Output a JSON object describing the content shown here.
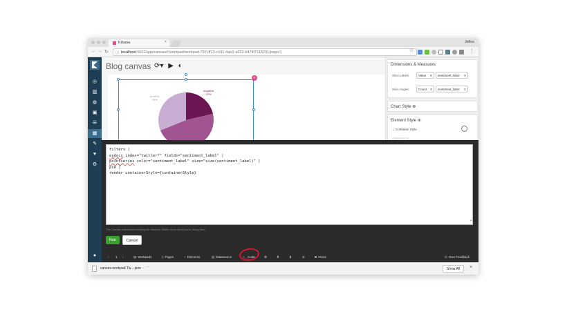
{
  "browser": {
    "tab_title": "Kibana",
    "tab_close": "×",
    "profile_name": "Jethro",
    "url_host": "localhost",
    "url_path": ":5601/app/canvas#/workpad/workpad-797cff13-c191-4ae3-a652-b474f7118231/page/1"
  },
  "workpad": {
    "title": "Blog canvas"
  },
  "pie": {
    "positive_label": "positive",
    "positive_pct": "33%",
    "negative_label": "negative",
    "negative_pct": "22%",
    "colors": [
      "#6b1652",
      "#a05592",
      "#c8aed2"
    ]
  },
  "panel": {
    "dimensions_title": "Dimensions & Measures",
    "slice_labels_label": "Slice Labels",
    "slice_labels_fn": "Value",
    "slice_labels_field": "sentiment_label",
    "slice_angles_label": "Slice Angles",
    "slice_angles_fn": "Count",
    "slice_angles_field": "sentiment_label",
    "chart_style": "Chart Style",
    "element_style": "Element Style",
    "container_style": "Container Style",
    "appearance": "Appearance"
  },
  "expression": {
    "lines": [
      "filters |",
      "esdocs index=\"twitter*\" fields=\"sentiment_label\" |",
      "pointseries color=\"sentiment_label\" size=\"size(sentiment_label)\" |",
      "pie |",
      "render containerStyle={containerStyle}"
    ],
    "help": "The Canvas expression backing the element. Better know what you're doing here.",
    "run_label": "Run",
    "cancel_label": "Cancel"
  },
  "footer": {
    "page_prev": "‹",
    "page_num": "1",
    "page_next": "›",
    "workpads": "Workpads",
    "pages": "Pages",
    "elements": "Elements",
    "datasource": "Datasource",
    "code": "Code",
    "clone": "Clone",
    "feedback": "Give Feedback"
  },
  "downloads": {
    "file": "canvas-workpad-Tw....json",
    "more": "···",
    "show_all": "Show All",
    "close": "×"
  },
  "icons": {
    "accent": "#e8488b",
    "sidebar_bg": "#1f3e53",
    "run_green": "#3aa12f",
    "annotation_red": "#d6162f"
  }
}
